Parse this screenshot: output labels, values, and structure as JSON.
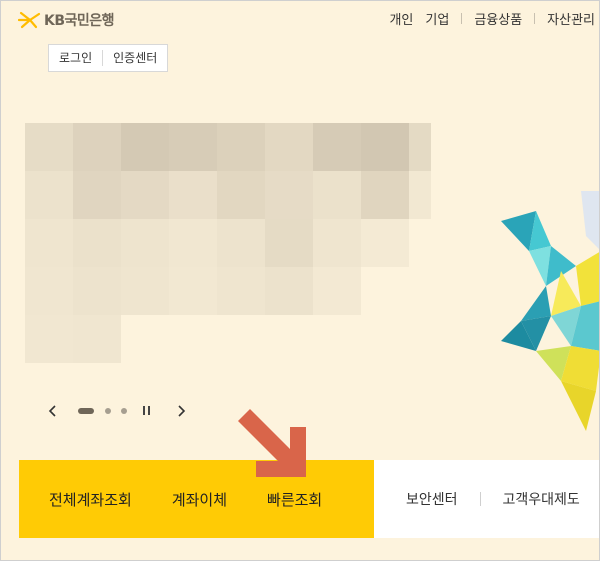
{
  "header": {
    "logo_text": "KB국민은행",
    "nav": [
      "개인",
      "기업",
      "금융상품",
      "자산관리"
    ]
  },
  "auth": {
    "login_label": "로그인",
    "cert_label": "인증센터"
  },
  "quick_menu": {
    "items": [
      "전체계좌조회",
      "계좌이체",
      "빠른조회"
    ],
    "sub_items": [
      "보안센터",
      "고객우대제도"
    ]
  },
  "colors": {
    "brand_yellow": "#ffcb05",
    "logo_gray": "#6f6658",
    "page_bg": "#fdf3dd",
    "annotation_arrow": "#d9654a"
  },
  "icons": {
    "logo": "kb-star-icon",
    "prev": "chevron-left-icon",
    "next": "chevron-right-icon",
    "pause": "pause-icon",
    "annotation": "red-arrow-icon"
  },
  "carousel": {
    "slide_count": 3,
    "active_slide": 1
  }
}
